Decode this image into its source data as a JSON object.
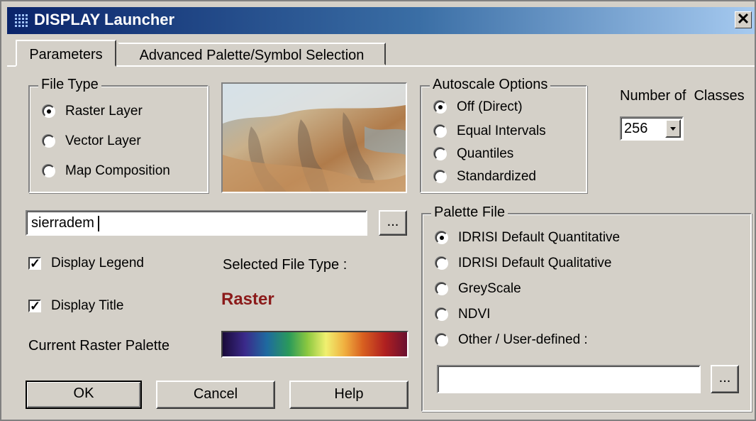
{
  "window": {
    "title": "DISPLAY Launcher",
    "close_glyph": "✕",
    "icon": "grid-icon"
  },
  "tabs": [
    {
      "label": "Parameters",
      "active": true
    },
    {
      "label": "Advanced Palette/Symbol Selection",
      "active": false
    }
  ],
  "file_type": {
    "legend": "File Type",
    "options": [
      {
        "label": "Raster Layer",
        "selected": true
      },
      {
        "label": "Vector Layer",
        "selected": false
      },
      {
        "label": "Map Composition",
        "selected": false
      }
    ]
  },
  "autoscale": {
    "legend": "Autoscale Options",
    "options": [
      {
        "label": "Off (Direct)",
        "selected": true
      },
      {
        "label": "Equal Intervals",
        "selected": false
      },
      {
        "label": "Quantiles",
        "selected": false
      },
      {
        "label": "Standardized",
        "selected": false
      }
    ]
  },
  "classes": {
    "label": "Number of  Classes",
    "value": "256"
  },
  "filename": {
    "value": "sierradem",
    "browse_label": "..."
  },
  "display_legend": {
    "label": "Display Legend",
    "checked": true
  },
  "display_title": {
    "label": "Display Title",
    "checked": true
  },
  "selected_type": {
    "label": "Selected File Type :",
    "value": "Raster",
    "color": "#8b1a1a"
  },
  "palette_label": "Current Raster Palette",
  "palette_file": {
    "legend": "Palette File",
    "options": [
      {
        "label": "IDRISI Default Quantitative",
        "selected": true
      },
      {
        "label": "IDRISI Default Qualitative",
        "selected": false
      },
      {
        "label": "GreyScale",
        "selected": false
      },
      {
        "label": "NDVI",
        "selected": false
      },
      {
        "label": "Other / User-defined :",
        "selected": false
      }
    ],
    "user_value": "",
    "browse_label": "..."
  },
  "buttons": {
    "ok": "OK",
    "cancel": "Cancel",
    "help": "Help"
  }
}
